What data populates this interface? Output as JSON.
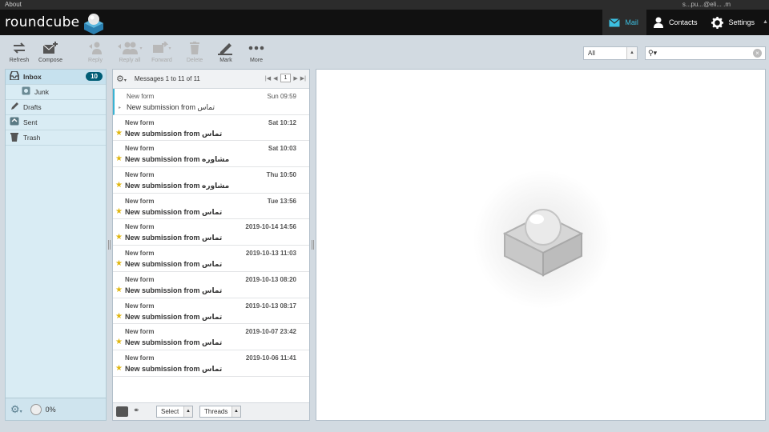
{
  "topbar": {
    "about": "About",
    "user": "s...pu...@eli...        .m"
  },
  "header": {
    "logo": "roundcube",
    "nav": [
      {
        "label": "Mail",
        "icon": "mail-icon",
        "active": true
      },
      {
        "label": "Contacts",
        "icon": "contacts-icon",
        "active": false
      },
      {
        "label": "Settings",
        "icon": "settings-icon",
        "active": false
      }
    ]
  },
  "toolbar": {
    "refresh": "Refresh",
    "compose": "Compose",
    "reply": "Reply",
    "reply_all": "Reply all",
    "forward": "Forward",
    "delete": "Delete",
    "mark": "Mark",
    "more": "More"
  },
  "filter": {
    "value": "All"
  },
  "search": {
    "placeholder": ""
  },
  "folders": [
    {
      "label": "Inbox",
      "icon": "inbox-icon",
      "badge": "10"
    },
    {
      "label": "Junk",
      "icon": "junk-icon"
    },
    {
      "label": "Drafts",
      "icon": "drafts-icon"
    },
    {
      "label": "Sent",
      "icon": "sent-icon"
    },
    {
      "label": "Trash",
      "icon": "trash-icon"
    }
  ],
  "quota": {
    "value": "0%"
  },
  "messagelist": {
    "count": "Messages 1 to 11 of 11",
    "page": "1",
    "messages": [
      {
        "from": "New form",
        "date": "Sun 09:59",
        "subject": "New submission from تماس"
      },
      {
        "from": "New form",
        "date": "Sat 10:12",
        "subject": "New submission from تماس"
      },
      {
        "from": "New form",
        "date": "Sat 10:03",
        "subject": "New submission from مشاوره"
      },
      {
        "from": "New form",
        "date": "Thu 10:50",
        "subject": "New submission from مشاوره"
      },
      {
        "from": "New form",
        "date": "Tue 13:56",
        "subject": "New submission from تماس"
      },
      {
        "from": "New form",
        "date": "2019-10-14 14:56",
        "subject": "New submission from تماس"
      },
      {
        "from": "New form",
        "date": "2019-10-13 11:03",
        "subject": "New submission from تماس"
      },
      {
        "from": "New form",
        "date": "2019-10-13 08:20",
        "subject": "New submission from تماس"
      },
      {
        "from": "New form",
        "date": "2019-10-13 08:17",
        "subject": "New submission from تماس"
      },
      {
        "from": "New form",
        "date": "2019-10-07 23:42",
        "subject": "New submission from تماس"
      },
      {
        "from": "New form",
        "date": "2019-10-06 11:41",
        "subject": "New submission from تماس"
      }
    ],
    "select": "Select",
    "threads": "Threads"
  },
  "colors": {
    "accent": "#39b3d3",
    "badge": "#005d76",
    "star": "#e0b60e"
  }
}
